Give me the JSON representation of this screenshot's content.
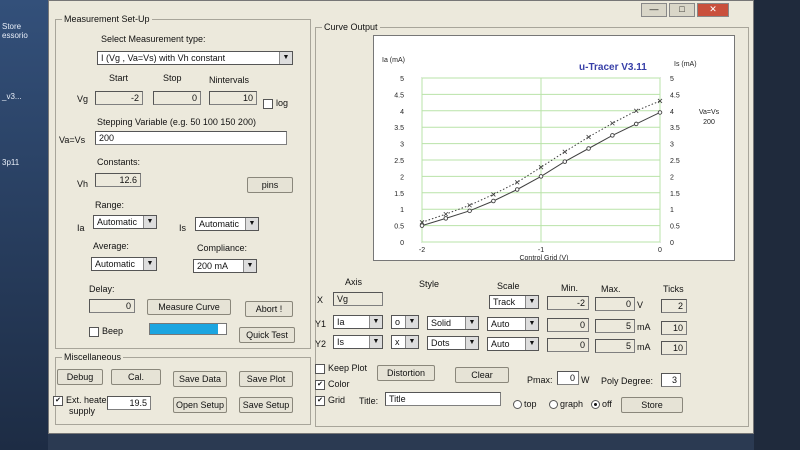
{
  "desktop": {
    "labels": [
      "Store",
      "essorio",
      "_v3...",
      "3p11"
    ]
  },
  "window": {
    "controls": [
      "—",
      "□",
      "✕"
    ]
  },
  "measurement": {
    "group_title": "Measurement Set-Up",
    "select_type_label": "Select Measurement type:",
    "type_value": "I (Vg , Va=Vs) with Vh constant",
    "start_label": "Start",
    "stop_label": "Stop",
    "nintervals_label": "Nintervals",
    "vg_label": "Vg",
    "vg_start": "-2",
    "vg_stop": "0",
    "vg_nintervals": "10",
    "log_label": "log",
    "stepping_label": "Stepping Variable (e.g. 50 100 150 200)",
    "vavs_label": "Va=Vs",
    "stepping_value": "200",
    "constants_label": "Constants:",
    "vh_label": "Vh",
    "vh_value": "12.6",
    "pins_label": "pins",
    "range_label": "Range:",
    "ia_label": "Ia",
    "ia_range": "Automatic",
    "is_label": "Is",
    "is_range": "Automatic",
    "average_label": "Average:",
    "average_value": "Automatic",
    "compliance_label": "Compliance:",
    "compliance_value": "200 mA",
    "delay_label": "Delay:",
    "delay_value": "0",
    "measure_label": "Measure Curve",
    "abort_label": "Abort !",
    "beep_label": "Beep",
    "quick_test_label": "Quick Test",
    "progress": 0.9
  },
  "misc": {
    "group_title": "Miscellaneous",
    "debug_label": "Debug",
    "cal_label": "Cal.",
    "save_data_label": "Save Data",
    "save_plot_label": "Save Plot",
    "ext_heater_label": "Ext. heater",
    "supply_label": "supply",
    "ext_heater_value": "19.5",
    "open_setup_label": "Open Setup",
    "save_setup_label": "Save Setup"
  },
  "curve": {
    "group_title": "Curve Output",
    "axis_label": "Axis",
    "style_label": "Style",
    "scale_label": "Scale",
    "min_label": "Min.",
    "max_label": "Max.",
    "ticks_label": "Ticks",
    "rows": [
      {
        "name": "X",
        "axis": "Vg",
        "marker": "",
        "line": "",
        "scale": "Track",
        "min": "-2",
        "max": "0",
        "unit": "V",
        "ticks": "2"
      },
      {
        "name": "Y1",
        "axis": "Ia",
        "marker": "o",
        "line": "Solid",
        "scale": "Auto",
        "min": "0",
        "max": "5",
        "unit": "mA",
        "ticks": "10"
      },
      {
        "name": "Y2",
        "axis": "Is",
        "marker": "x",
        "line": "Dots",
        "scale": "Auto",
        "min": "0",
        "max": "5",
        "unit": "mA",
        "ticks": "10"
      }
    ],
    "keep_plot_label": "Keep Plot",
    "color_label": "Color",
    "grid_label": "Grid",
    "title_label": "Title:",
    "title_value": "Title",
    "distortion_label": "Distortion",
    "clear_label": "Clear",
    "pmax_label": "Pmax:",
    "pmax_value": "0",
    "pmax_unit": "W",
    "poly_label": "Poly Degree:",
    "poly_value": "3",
    "legend_top": "top",
    "legend_graph": "graph",
    "legend_off": "off",
    "store_label": "Store"
  },
  "chart_data": {
    "type": "line",
    "title": "u-Tracer V3.11",
    "xlabel": "Control Grid (V)",
    "ylabel": "Ia (mA)",
    "y2label": "Is (mA)",
    "legend_text": [
      "Va=Vs",
      "200"
    ],
    "xlim": [
      -2,
      0
    ],
    "ylim": [
      0,
      5
    ],
    "x_ticks": [
      "-2",
      "-1",
      "0"
    ],
    "y_ticks": [
      "0",
      "0.5",
      "1",
      "1.5",
      "2",
      "2.5",
      "3",
      "3.5",
      "4",
      "4.5",
      "5"
    ],
    "grid": true,
    "series": [
      {
        "marker": "circle",
        "line": "solid",
        "color": "#404040",
        "x": [
          -2,
          -1.8,
          -1.6,
          -1.4,
          -1.2,
          -1.0,
          -0.8,
          -0.6,
          -0.4,
          -0.2,
          0
        ],
        "y": [
          0.5,
          0.72,
          0.95,
          1.25,
          1.6,
          2.0,
          2.45,
          2.85,
          3.25,
          3.6,
          3.95
        ]
      },
      {
        "marker": "x",
        "line": "dots",
        "color": "#404040",
        "x": [
          -2,
          -1.8,
          -1.6,
          -1.4,
          -1.2,
          -1.0,
          -0.8,
          -0.6,
          -0.4,
          -0.2,
          0
        ],
        "y": [
          0.6,
          0.85,
          1.12,
          1.45,
          1.82,
          2.28,
          2.75,
          3.2,
          3.62,
          4.0,
          4.3
        ]
      }
    ]
  }
}
